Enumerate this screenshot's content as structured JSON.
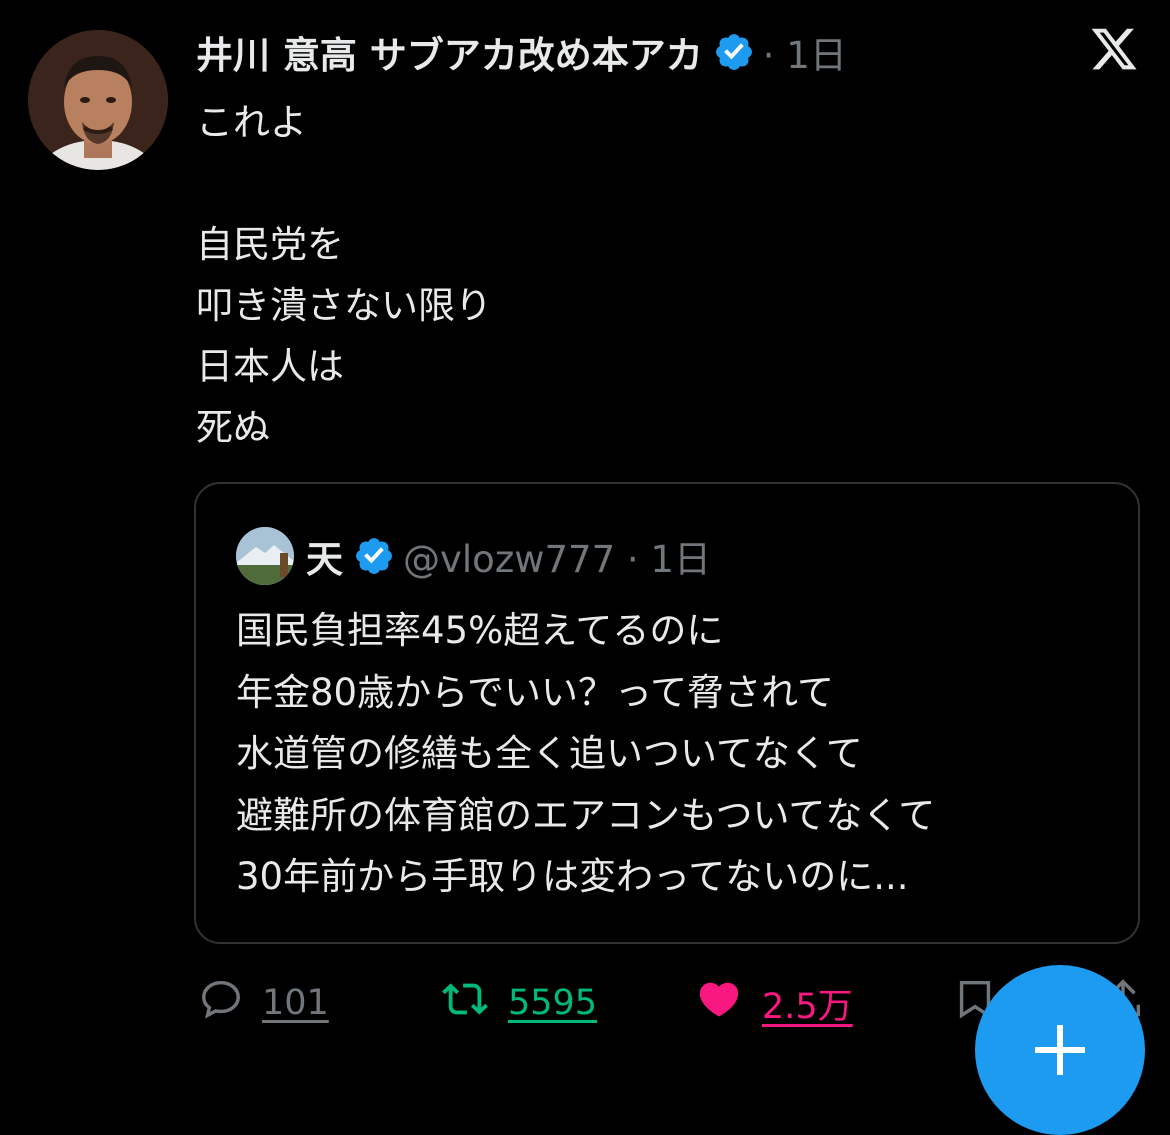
{
  "tweet": {
    "author_name": "井川 意高 サブアカ改め本アカ",
    "time": "· 1日",
    "lines": [
      "これよ",
      "",
      "自民党を",
      "叩き潰さない限り",
      "日本人は",
      "死ぬ"
    ]
  },
  "quote": {
    "author_name": "天",
    "handle_time": "@vlozw777 · 1日",
    "lines": [
      "国民負担率45%超えてるのに",
      "年金80歳からでいい？って脅されて",
      "水道管の修繕も全く追いついてなくて",
      "避難所の体育館のエアコンもついてなくて",
      "30年前から手取りは変わってないのに..."
    ]
  },
  "actions": {
    "reply_count": "101",
    "retweet_count": "5595",
    "like_count": "2.5万"
  },
  "icons": {
    "verified": "verified-badge-icon",
    "logo": "x-logo-icon",
    "reply": "reply-icon",
    "retweet": "retweet-icon",
    "like": "heart-icon",
    "bookmark": "bookmark-icon",
    "share": "share-icon",
    "compose": "plus-icon"
  },
  "colors": {
    "background": "#000000",
    "verified": "#1d9bf0",
    "retweet": "#00ba7c",
    "like": "#f91880",
    "secondary_text": "#71767b"
  }
}
